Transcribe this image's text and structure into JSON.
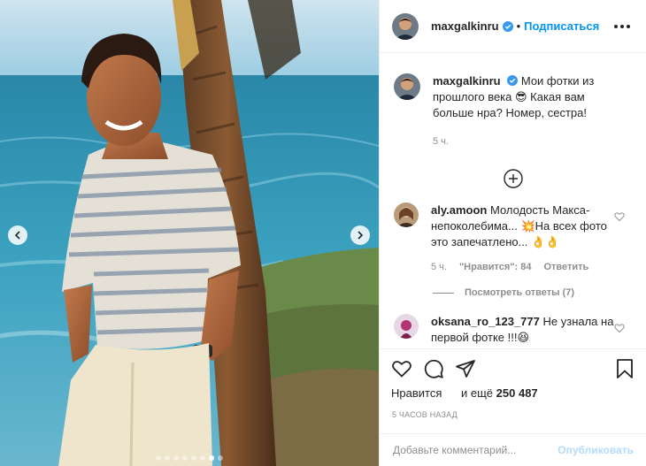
{
  "post": {
    "photo_alt": "photo",
    "carousel": {
      "total": 8,
      "active": 7
    }
  },
  "header": {
    "username": "maxgalkinru",
    "separator": "•",
    "follow_label": "Подписаться"
  },
  "caption": {
    "username": "maxgalkinru",
    "text": "Мои фотки из прошлого века 😎 Какая вам больше нра? Номер, сестра!",
    "time": "5 ч."
  },
  "comments": [
    {
      "username": "aly.amoon",
      "text": "Молодость Макса-непоколебима... 💥На всех фото это запечатлено... 👌👌",
      "time": "5 ч.",
      "likes": "\"Нравится\": 84",
      "reply_label": "Ответить",
      "view_replies": "Посмотреть ответы (7)"
    },
    {
      "username": "oksana_ro_123_777",
      "text": "Не узнала на первой фотке !!!😆"
    }
  ],
  "actions": {
    "likes_prefix": "Нравится",
    "likes_mid": "и ещё",
    "likes_count": "250 487",
    "time_ago": "5 ЧАСОВ НАЗАД"
  },
  "add_comment": {
    "placeholder": "Добавьте комментарий...",
    "post_label": "Опубликовать"
  },
  "icons": {
    "more": "more-icon",
    "verified": "verified-badge-icon",
    "heart": "heart-icon",
    "comment": "comment-icon",
    "share": "share-icon",
    "save": "bookmark-icon",
    "load_more": "plus-circle-icon"
  },
  "colors": {
    "accent": "#0095f6",
    "post_disabled": "#b3dbff",
    "muted": "#8e8e8e",
    "text": "#262626"
  }
}
